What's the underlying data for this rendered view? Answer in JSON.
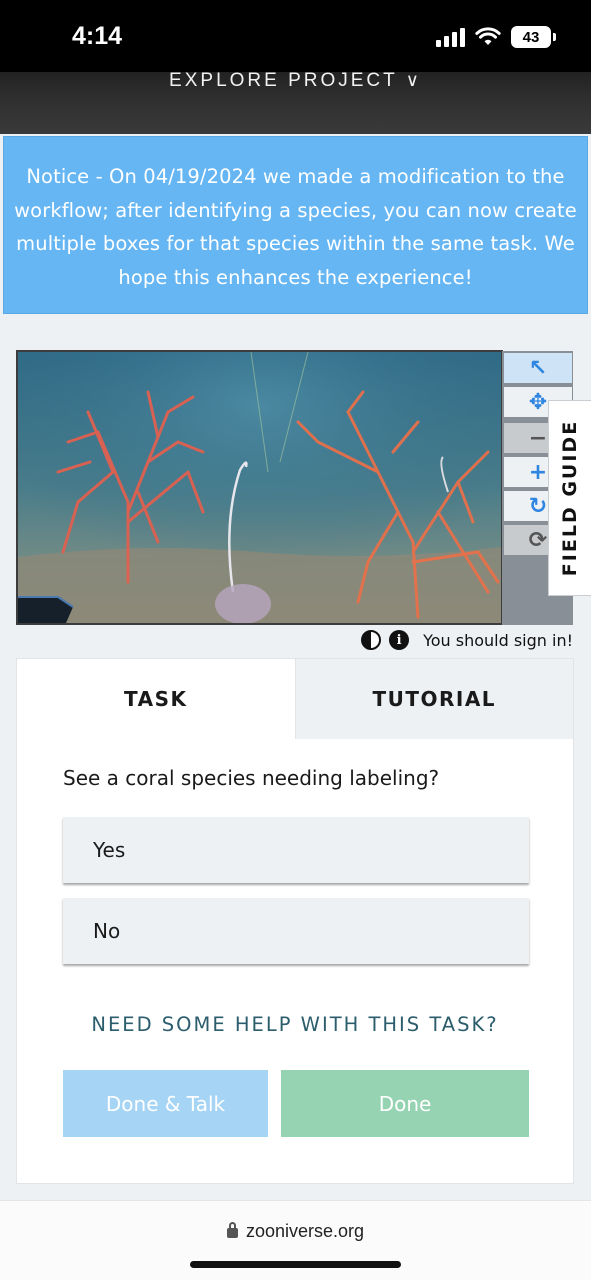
{
  "status_bar": {
    "time": "4:14",
    "battery": "43"
  },
  "project": {
    "explore_label": "EXPLORE PROJECT"
  },
  "notice": {
    "text": "Notice - On 04/19/2024 we made a modification to the workflow; after identifying a species, you can now create multiple boxes for that species within the same task. We hope this enhances the experience!"
  },
  "viewer": {
    "tools": [
      {
        "name": "pointer-icon",
        "glyph": "↖"
      },
      {
        "name": "move-icon",
        "glyph": "✥"
      },
      {
        "name": "zoom-out-icon",
        "glyph": "−"
      },
      {
        "name": "zoom-in-icon",
        "glyph": "+"
      },
      {
        "name": "rotate-icon",
        "glyph": "↻"
      },
      {
        "name": "reset-icon",
        "glyph": "⟳"
      }
    ],
    "field_guide_label": "FIELD GUIDE",
    "sign_in_text": "You should sign in!"
  },
  "task": {
    "tabs": {
      "task": "TASK",
      "tutorial": "TUTORIAL"
    },
    "question": "See a coral species needing labeling?",
    "answers": [
      "Yes",
      "No"
    ],
    "help_label": "NEED SOME HELP WITH THIS TASK?",
    "buttons": {
      "done_talk": "Done & Talk",
      "done": "Done"
    }
  },
  "browser": {
    "url": "zooniverse.org"
  },
  "colors": {
    "notice_bg": "#66b6f4",
    "done_talk_bg": "#a6d4f5",
    "done_bg": "#95d3b2",
    "help_text": "#2b5d6c"
  }
}
